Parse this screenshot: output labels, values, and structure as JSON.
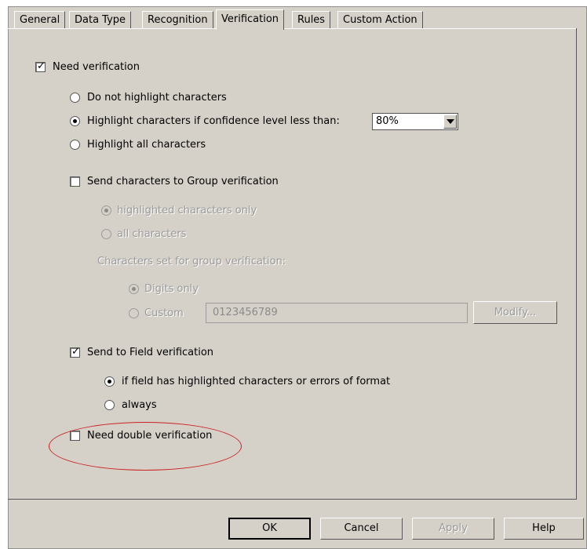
{
  "tabs": [
    "General",
    "Data Type",
    "Recognition",
    "Verification",
    "Rules",
    "Custom Action"
  ],
  "active_tab": "Verification",
  "need_verification": {
    "label": "Need verification",
    "checked": true
  },
  "highlight_options": [
    {
      "label": "Do not highlight characters",
      "selected": false
    },
    {
      "label": "Highlight characters if confidence level less than:",
      "selected": true
    },
    {
      "label": "Highlight all characters",
      "selected": false
    }
  ],
  "confidence_select": {
    "value": "80%"
  },
  "group_verification": {
    "label": "Send characters to Group verification",
    "checked": false,
    "options": [
      {
        "label": "highlighted characters only",
        "selected": true
      },
      {
        "label": "all characters",
        "selected": false
      }
    ],
    "charset_label": "Characters set for group verification:",
    "charset_options": [
      {
        "label": "Digits only",
        "selected": true
      },
      {
        "label": "Custom",
        "selected": false
      }
    ],
    "custom_value": "0123456789",
    "modify_label": "Modify..."
  },
  "field_verification": {
    "label": "Send to Field verification",
    "checked": true,
    "options": [
      {
        "label": "if field has highlighted characters or errors of format",
        "selected": true
      },
      {
        "label": "always",
        "selected": false
      }
    ]
  },
  "double_verification": {
    "label": "Need double verification",
    "checked": false
  },
  "buttons": {
    "ok": "OK",
    "cancel": "Cancel",
    "apply": "Apply",
    "help": "Help"
  },
  "colors": {
    "dialog_bg": "#d5d1c9",
    "annotation": "#cc2222"
  }
}
